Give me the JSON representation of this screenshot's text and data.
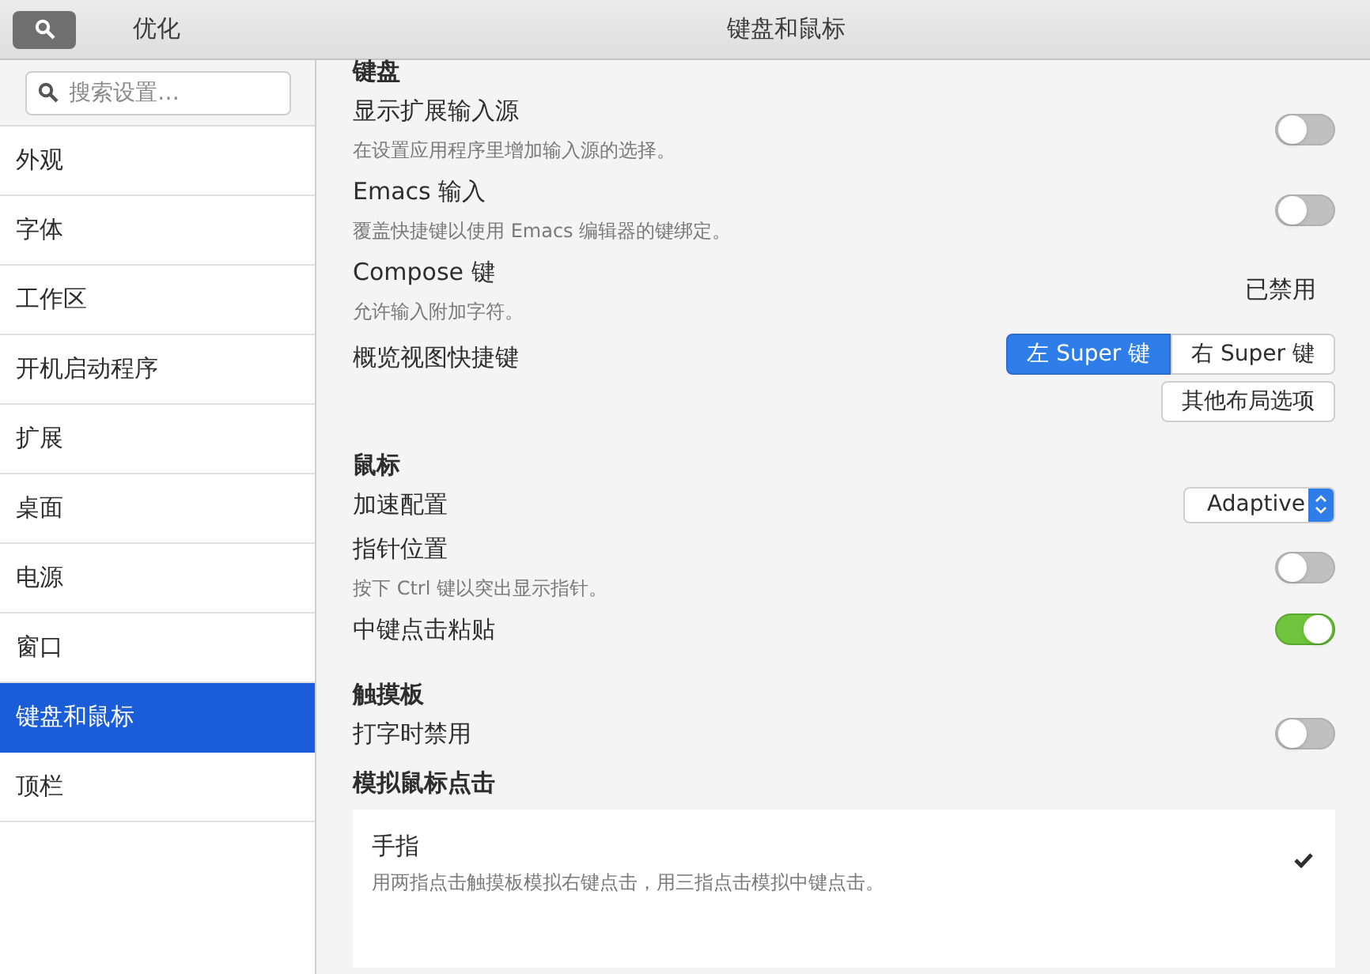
{
  "header": {
    "app_title": "优化",
    "page_title": "键盘和鼠标"
  },
  "search": {
    "placeholder": "搜索设置…"
  },
  "sidebar": {
    "items": [
      {
        "label": "外观",
        "selected": false
      },
      {
        "label": "字体",
        "selected": false
      },
      {
        "label": "工作区",
        "selected": false
      },
      {
        "label": "开机启动程序",
        "selected": false
      },
      {
        "label": "扩展",
        "selected": false
      },
      {
        "label": "桌面",
        "selected": false
      },
      {
        "label": "电源",
        "selected": false
      },
      {
        "label": "窗口",
        "selected": false
      },
      {
        "label": "键盘和鼠标",
        "selected": true
      },
      {
        "label": "顶栏",
        "selected": false
      }
    ]
  },
  "sections": [
    {
      "title": "键盘",
      "rows": [
        {
          "kind": "toggle",
          "label": "显示扩展输入源",
          "description": "在设置应用程序里增加输入源的选择。",
          "on": false
        },
        {
          "kind": "toggle",
          "label": "Emacs 输入",
          "description": "覆盖快捷键以使用 Emacs 编辑器的键绑定。",
          "on": false
        },
        {
          "kind": "status",
          "label": "Compose 键",
          "description": "允许输入附加字符。",
          "value": "已禁用"
        },
        {
          "kind": "segmented",
          "label": "概览视图快捷键",
          "options": [
            {
              "label": "左 Super 键",
              "selected": true
            },
            {
              "label": "右 Super 键",
              "selected": false
            }
          ],
          "button": "其他布局选项"
        }
      ]
    },
    {
      "title": "鼠标",
      "rows": [
        {
          "kind": "select",
          "label": "加速配置",
          "value": "Adaptive"
        },
        {
          "kind": "toggle",
          "label": "指针位置",
          "description": "按下 Ctrl 键以突出显示指针。",
          "on": false
        },
        {
          "kind": "toggle",
          "label": "中键点击粘贴",
          "on": true
        }
      ]
    },
    {
      "title": "触摸板",
      "rows": [
        {
          "kind": "toggle",
          "label": "打字时禁用",
          "on": false
        }
      ]
    },
    {
      "title": "模拟鼠标点击",
      "rows": [
        {
          "kind": "card",
          "label": "手指",
          "description": "用两指点击触摸板模拟右键点击，用三指点击模拟中键点击。",
          "checked": true
        }
      ]
    }
  ]
}
